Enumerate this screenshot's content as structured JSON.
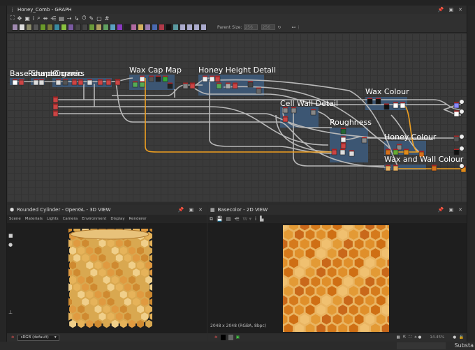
{
  "graph_panel": {
    "title": "Honey_Comb - GRAPH",
    "parent_size_label": "Parent Size:",
    "parent_size_value": "256",
    "parent_size_value2": "256"
  },
  "frames": [
    "Base Shape",
    "Round Corners",
    "Organic",
    "Wax Cap Map",
    "Honey Height Detail",
    "Cell Wall Detail",
    "Roughness",
    "Wax Colour",
    "Honey Colour",
    "Wax and Wall Colour"
  ],
  "view3d": {
    "title": "Rounded Cylinder - OpenGL - 3D VIEW",
    "menu": [
      "Scene",
      "Materials",
      "Lights",
      "Camera",
      "Environment",
      "Display",
      "Renderer"
    ],
    "colorspace": "sRGB (default)"
  },
  "view2d": {
    "title": "Basecolor - 2D VIEW",
    "resolution": "2048 x 2048 (RGBA, 8bpc)",
    "zoom": "14.45%"
  },
  "status": {
    "app": "Substa"
  },
  "colors": {
    "frame": "#3d5a7a",
    "wire": "#b5b5b5",
    "orange_wire": "#f0a020",
    "honey": "#e08a1a"
  }
}
